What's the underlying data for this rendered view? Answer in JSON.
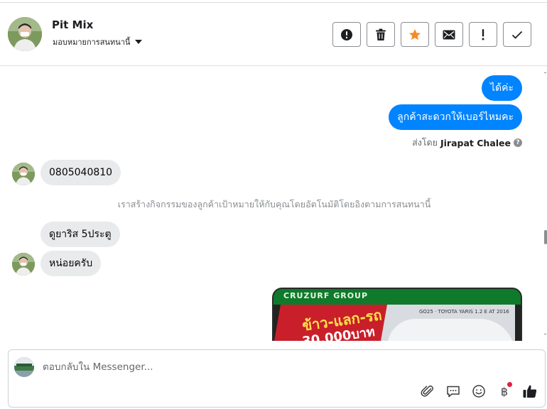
{
  "header": {
    "contact_name": "Pit Mix",
    "assign_label": "มอบหมายการสนทนานี้",
    "actions": [
      {
        "name": "mark-spam",
        "icon": "exclamation-circle-icon"
      },
      {
        "name": "delete",
        "icon": "trash-icon"
      },
      {
        "name": "star",
        "icon": "star-icon"
      },
      {
        "name": "mark-unread",
        "icon": "envelope-icon"
      },
      {
        "name": "follow-up",
        "icon": "exclamation-icon"
      },
      {
        "name": "done",
        "icon": "check-icon"
      }
    ],
    "star_color": "#f58b27"
  },
  "conversation": {
    "outgoing": [
      {
        "text": "ได้ค่ะ"
      },
      {
        "text": "ลูกค้าสะดวกให้เบอร์ไหมคะ"
      }
    ],
    "sent_by_prefix": "ส่งโดย",
    "sent_by_name": "Jirapat Chalee",
    "incoming_1": "0805040810",
    "system_note": "เราสร้างกิจกรรมของลูกค้าเป้าหมายให้กับคุณโดยอัตโนมัติโดยอิงตามการสนทนานี้",
    "incoming_2": "ดูยาริส 5ประตู",
    "incoming_3": "หน่อยครับ",
    "image_attachment": {
      "banner_text": "CRUZURF GROUP",
      "promo_line1": "ข้าว-แลก-รถ",
      "promo_line2": "30,000บาท",
      "caption": "GO25 · TOYOTA YARIS 1.2 E AT 2016"
    },
    "outgoing_color": "#0084ff",
    "incoming_color": "#e9eaec"
  },
  "composer": {
    "placeholder": "ตอบกลับใน Messenger...",
    "tools": [
      "paperclip-icon",
      "chat-bubble-icon",
      "smiley-icon",
      "baht-icon",
      "thumbs-up-icon"
    ],
    "baht_symbol": "฿"
  }
}
